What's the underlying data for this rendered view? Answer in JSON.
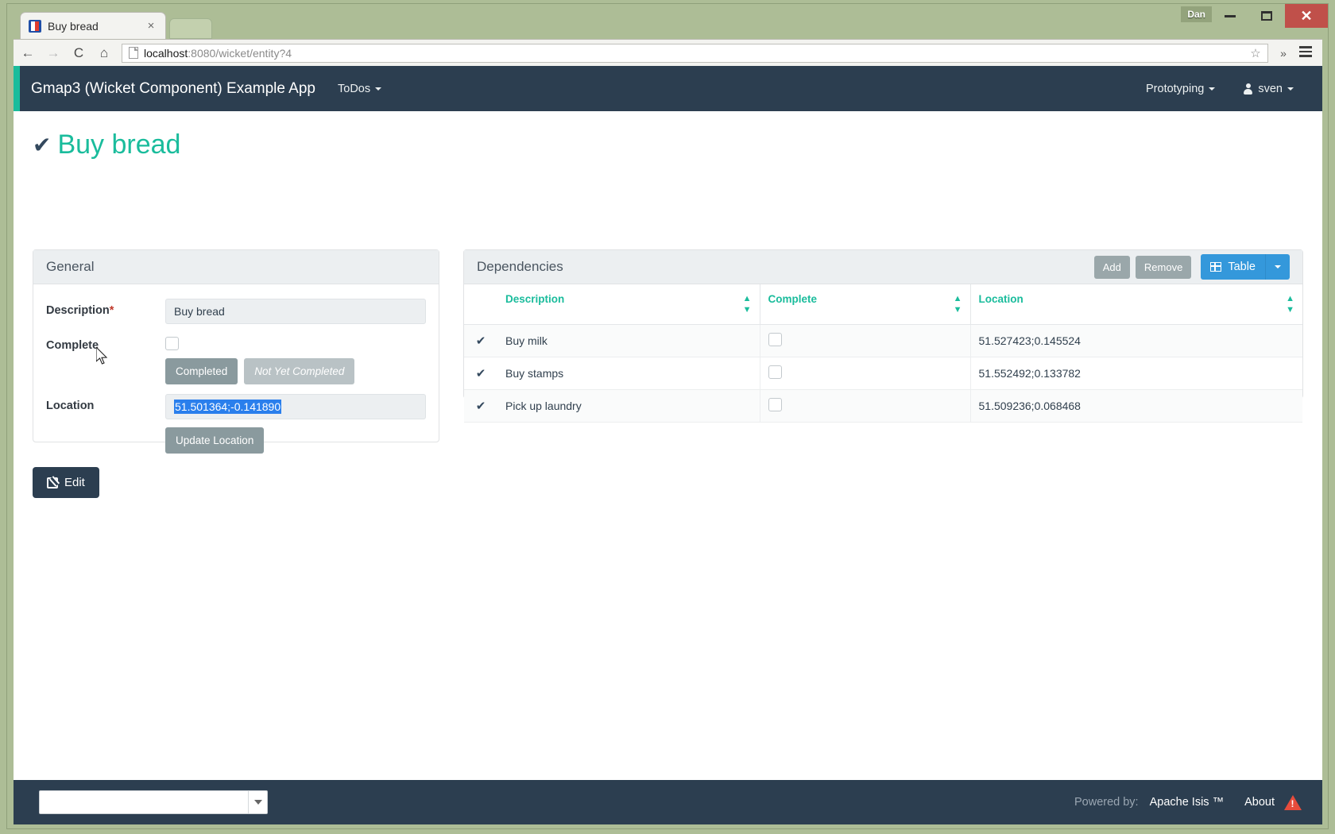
{
  "window": {
    "user_chip": "Dan",
    "minimize_label": "Minimize",
    "maximize_label": "Maximize",
    "close_label": "Close"
  },
  "browser": {
    "tab": {
      "title": "Buy bread",
      "close": "×",
      "favicon": "app-favicon"
    },
    "back_icon": "←",
    "forward_icon": "→",
    "reload_icon": "C",
    "home_icon": "⌂",
    "url_host": "localhost",
    "url_rest": ":8080/wicket/entity?4",
    "star_icon": "☆",
    "overflow_icon": "»"
  },
  "navbar": {
    "brand": "Gmap3 (Wicket Component) Example App",
    "todos": "ToDos",
    "prototyping": "Prototyping",
    "user": "sven"
  },
  "page": {
    "title": "Buy bread"
  },
  "general": {
    "panel_title": "General",
    "description_label": "Description",
    "description_required": "*",
    "description_value": "Buy bread",
    "complete_label": "Complete",
    "complete_checked": false,
    "completed_button": "Completed",
    "not_yet_completed_button": "Not Yet Completed",
    "location_label": "Location",
    "location_value": "51.501364;-0.141890",
    "update_location_button": "Update Location",
    "edit_button": "Edit"
  },
  "dependencies": {
    "panel_title": "Dependencies",
    "add_button": "Add",
    "remove_button": "Remove",
    "view_button": "Table",
    "columns": [
      "Description",
      "Complete",
      "Location"
    ],
    "rows": [
      {
        "description": "Buy milk",
        "complete": false,
        "location": "51.527423;0.145524"
      },
      {
        "description": "Buy stamps",
        "complete": false,
        "location": "51.552492;0.133782"
      },
      {
        "description": "Pick up laundry",
        "complete": false,
        "location": "51.509236;0.068468"
      }
    ]
  },
  "footer": {
    "select_value": "",
    "powered_by": "Powered by:",
    "apache_isis": "Apache Isis ™",
    "about": "About"
  },
  "colors": {
    "navbar": "#2c3e50",
    "accent_teal": "#1abc9c",
    "primary_blue": "#3498db",
    "required_red": "#c0392b",
    "selection_blue": "#2a7fec",
    "os_chrome": "#adbd96"
  }
}
